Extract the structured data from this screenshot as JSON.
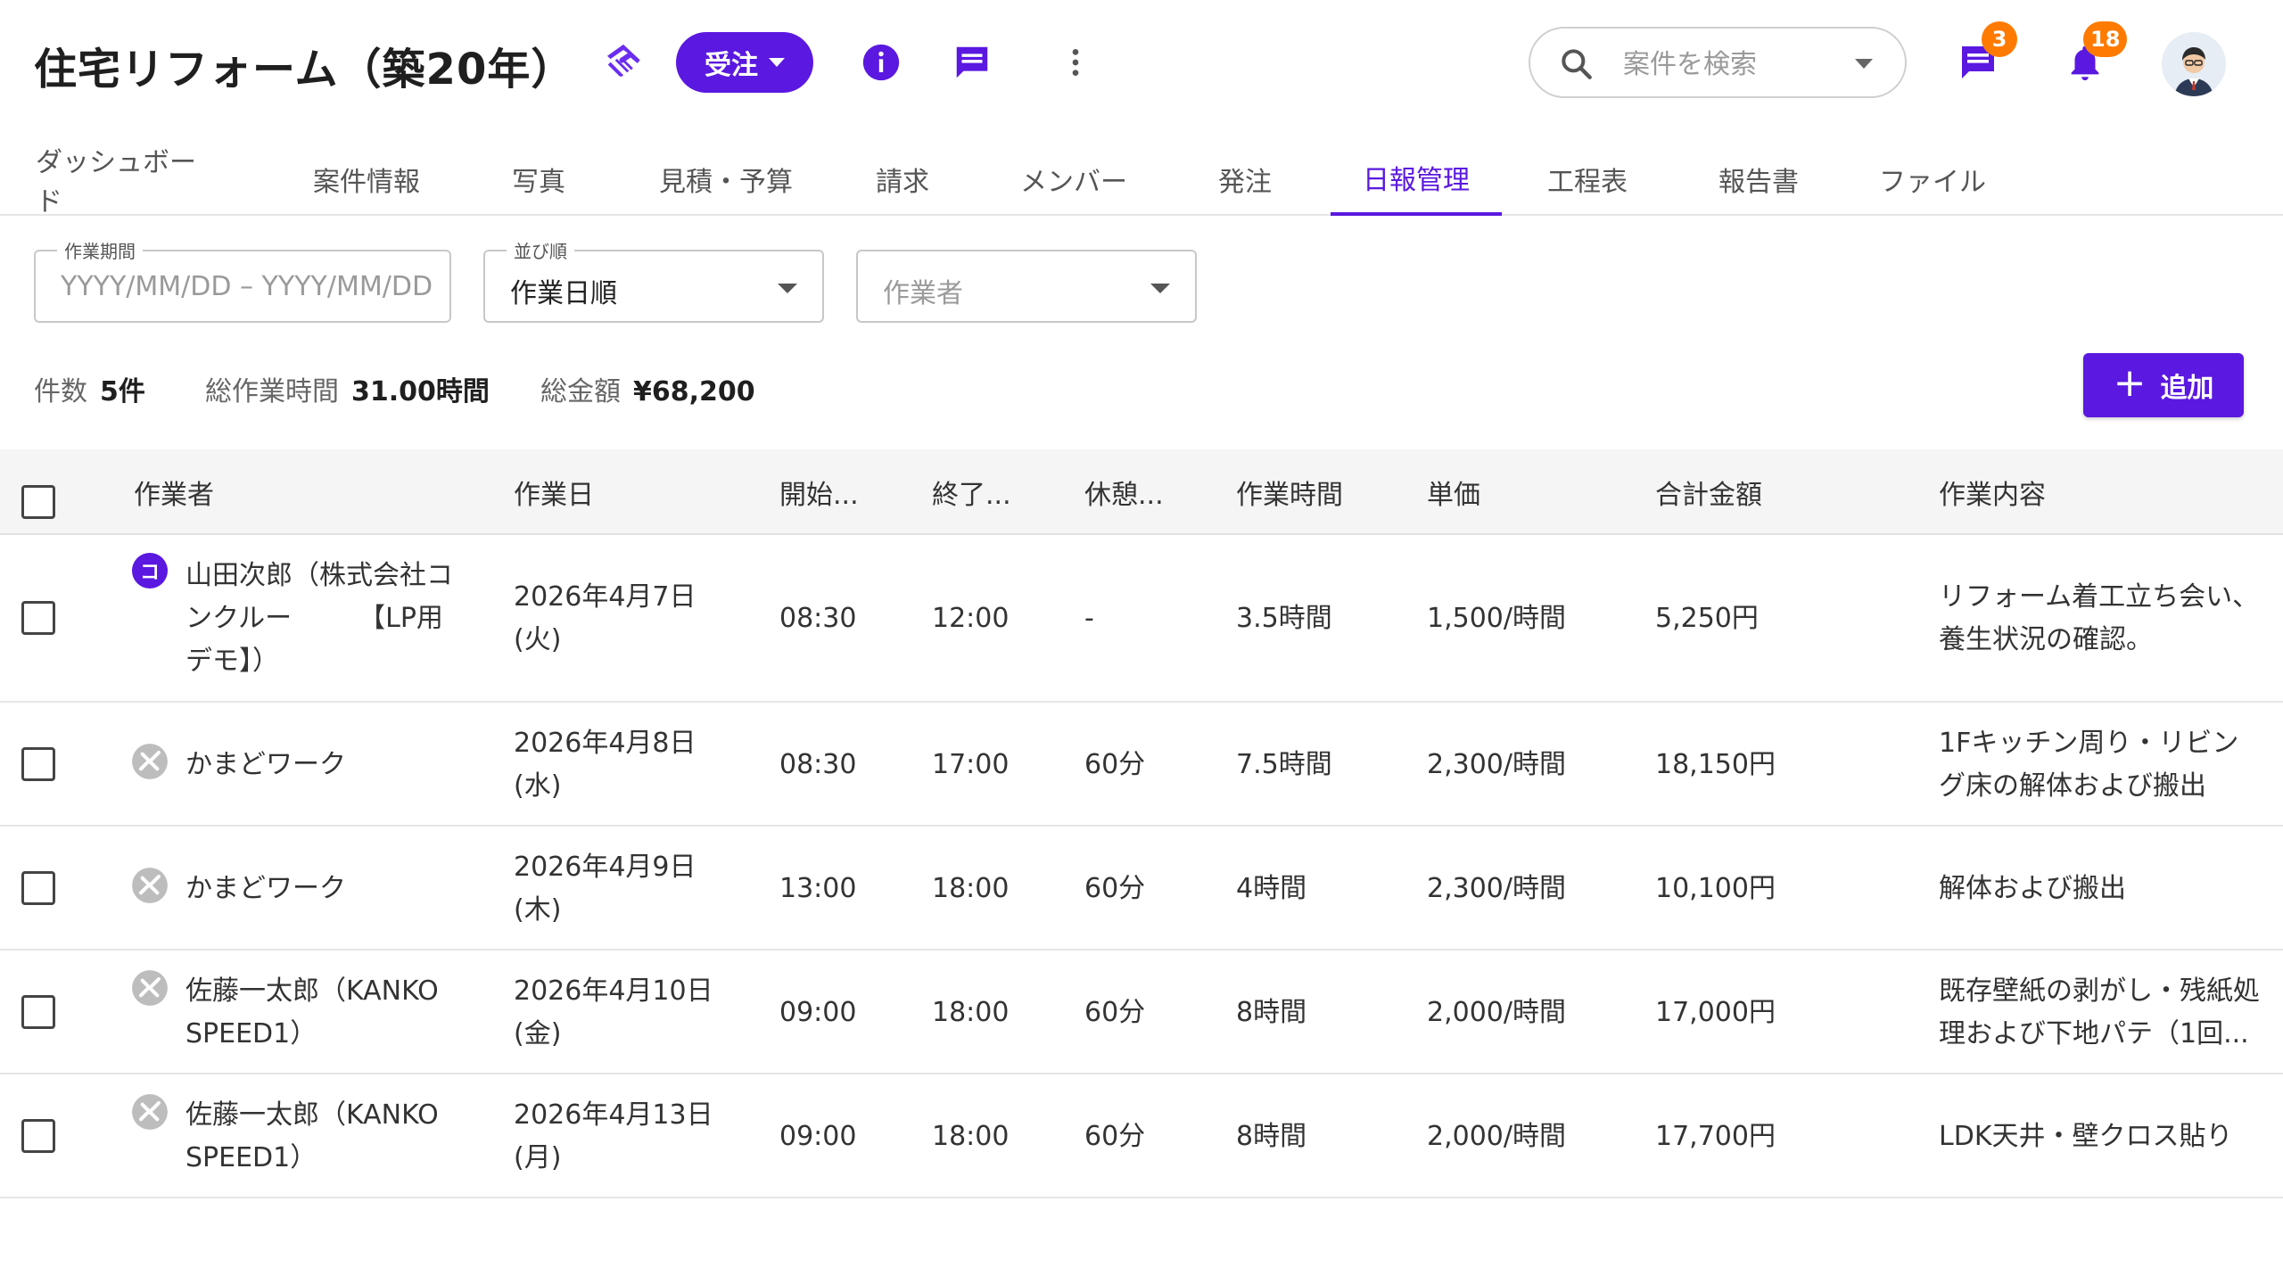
{
  "header": {
    "title": "住宅リフォーム（築20年）",
    "status_label": "受注",
    "search_placeholder": "案件を検索",
    "chat_badge": "3",
    "notification_badge": "18"
  },
  "tabs": [
    {
      "label": "ダッシュボード"
    },
    {
      "label": "案件情報"
    },
    {
      "label": "写真"
    },
    {
      "label": "見積・予算"
    },
    {
      "label": "請求"
    },
    {
      "label": "メンバー"
    },
    {
      "label": "発注"
    },
    {
      "label": "日報管理"
    },
    {
      "label": "工程表"
    },
    {
      "label": "報告書"
    },
    {
      "label": "ファイル"
    }
  ],
  "active_tab": "日報管理",
  "filters": {
    "period_label": "作業期間",
    "period_placeholder": "YYYY/MM/DD – YYYY/MM/DD",
    "sort_label": "並び順",
    "sort_value": "作業日順",
    "worker_placeholder": "作業者"
  },
  "summary": {
    "count_label": "件数",
    "count_value": "5件",
    "hours_label": "総作業時間",
    "hours_value": "31.00時間",
    "amount_label": "総金額",
    "amount_value": "¥68,200"
  },
  "add_button_label": "追加",
  "table": {
    "columns": [
      "作業者",
      "作業日",
      "開始...",
      "終了...",
      "休憩...",
      "作業時間",
      "単価",
      "合計金額",
      "作業内容"
    ],
    "rows": [
      {
        "worker": "山田次郎（株式会社コンクルー　　　【LP用デモ】）",
        "date": "2026年4月7日(火)",
        "start": "08:30",
        "end": "12:00",
        "break": "-",
        "hours": "3.5時間",
        "rate": "1,500/時間",
        "total": "5,250円",
        "content": "リフォーム着工立ち会い、養生状況の確認。",
        "icon_letter": "コ"
      },
      {
        "worker": "かまどワーク",
        "date": "2026年4月8日(水)",
        "start": "08:30",
        "end": "17:00",
        "break": "60分",
        "hours": "7.5時間",
        "rate": "2,300/時間",
        "total": "18,150円",
        "content": "1Fキッチン周り・リビング床の解体および搬出"
      },
      {
        "worker": "かまどワーク",
        "date": "2026年4月9日(木)",
        "start": "13:00",
        "end": "18:00",
        "break": "60分",
        "hours": "4時間",
        "rate": "2,300/時間",
        "total": "10,100円",
        "content": "解体および搬出"
      },
      {
        "worker": "佐藤一太郎（KANKO SPEED1）",
        "date": "2026年4月10日(金)",
        "start": "09:00",
        "end": "18:00",
        "break": "60分",
        "hours": "8時間",
        "rate": "2,000/時間",
        "total": "17,000円",
        "content": "既存壁紙の剥がし・残紙処理および下地パテ（1回..."
      },
      {
        "worker": "佐藤一太郎（KANKO SPEED1）",
        "date": "2026年4月13日(月)",
        "start": "09:00",
        "end": "18:00",
        "break": "60分",
        "hours": "8時間",
        "rate": "2,000/時間",
        "total": "17,700円",
        "content": "LDK天井・壁クロス貼り"
      }
    ]
  }
}
